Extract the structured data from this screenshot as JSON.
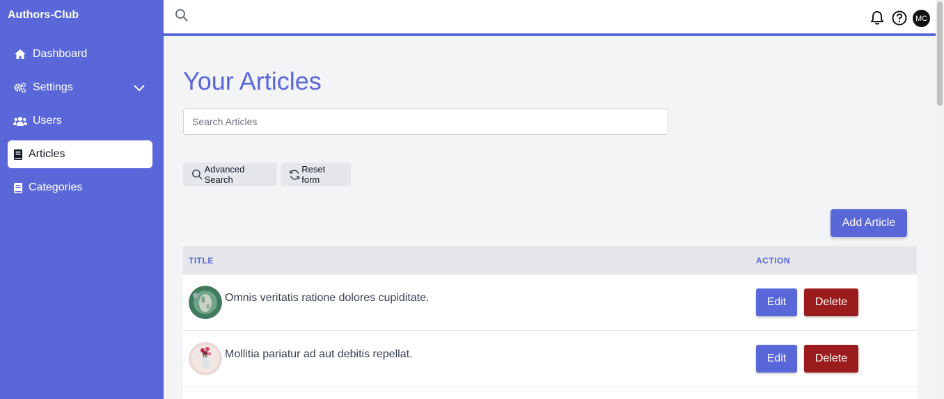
{
  "app": {
    "brand": "Authors-Club"
  },
  "sidebar": {
    "items": [
      {
        "label": "Dashboard",
        "icon": "home-icon",
        "active": false
      },
      {
        "label": "Settings",
        "icon": "gears-icon",
        "active": false,
        "expandable": true
      },
      {
        "label": "Users",
        "icon": "users-icon",
        "active": false
      },
      {
        "label": "Articles",
        "icon": "book-icon",
        "active": true
      },
      {
        "label": "Categories",
        "icon": "book-icon",
        "active": false
      }
    ]
  },
  "topbar": {
    "avatar_initials": "MC"
  },
  "main": {
    "title": "Your Articles",
    "search_placeholder": "Search Articles",
    "advanced_search_label": "Advanced Search",
    "reset_label": "Reset form",
    "add_label": "Add Article"
  },
  "table": {
    "columns": [
      "TITLE",
      "ACTION"
    ],
    "rows": [
      {
        "title": "Omnis veritatis ratione dolores cupiditate.",
        "edit_label": "Edit",
        "delete_label": "Delete"
      },
      {
        "title": "Mollitia pariatur ad aut debitis repellat.",
        "edit_label": "Edit",
        "delete_label": "Delete"
      }
    ]
  },
  "colors": {
    "accent": "#5a67d8",
    "danger": "#9b1c1c",
    "background": "#f3f4f6"
  }
}
